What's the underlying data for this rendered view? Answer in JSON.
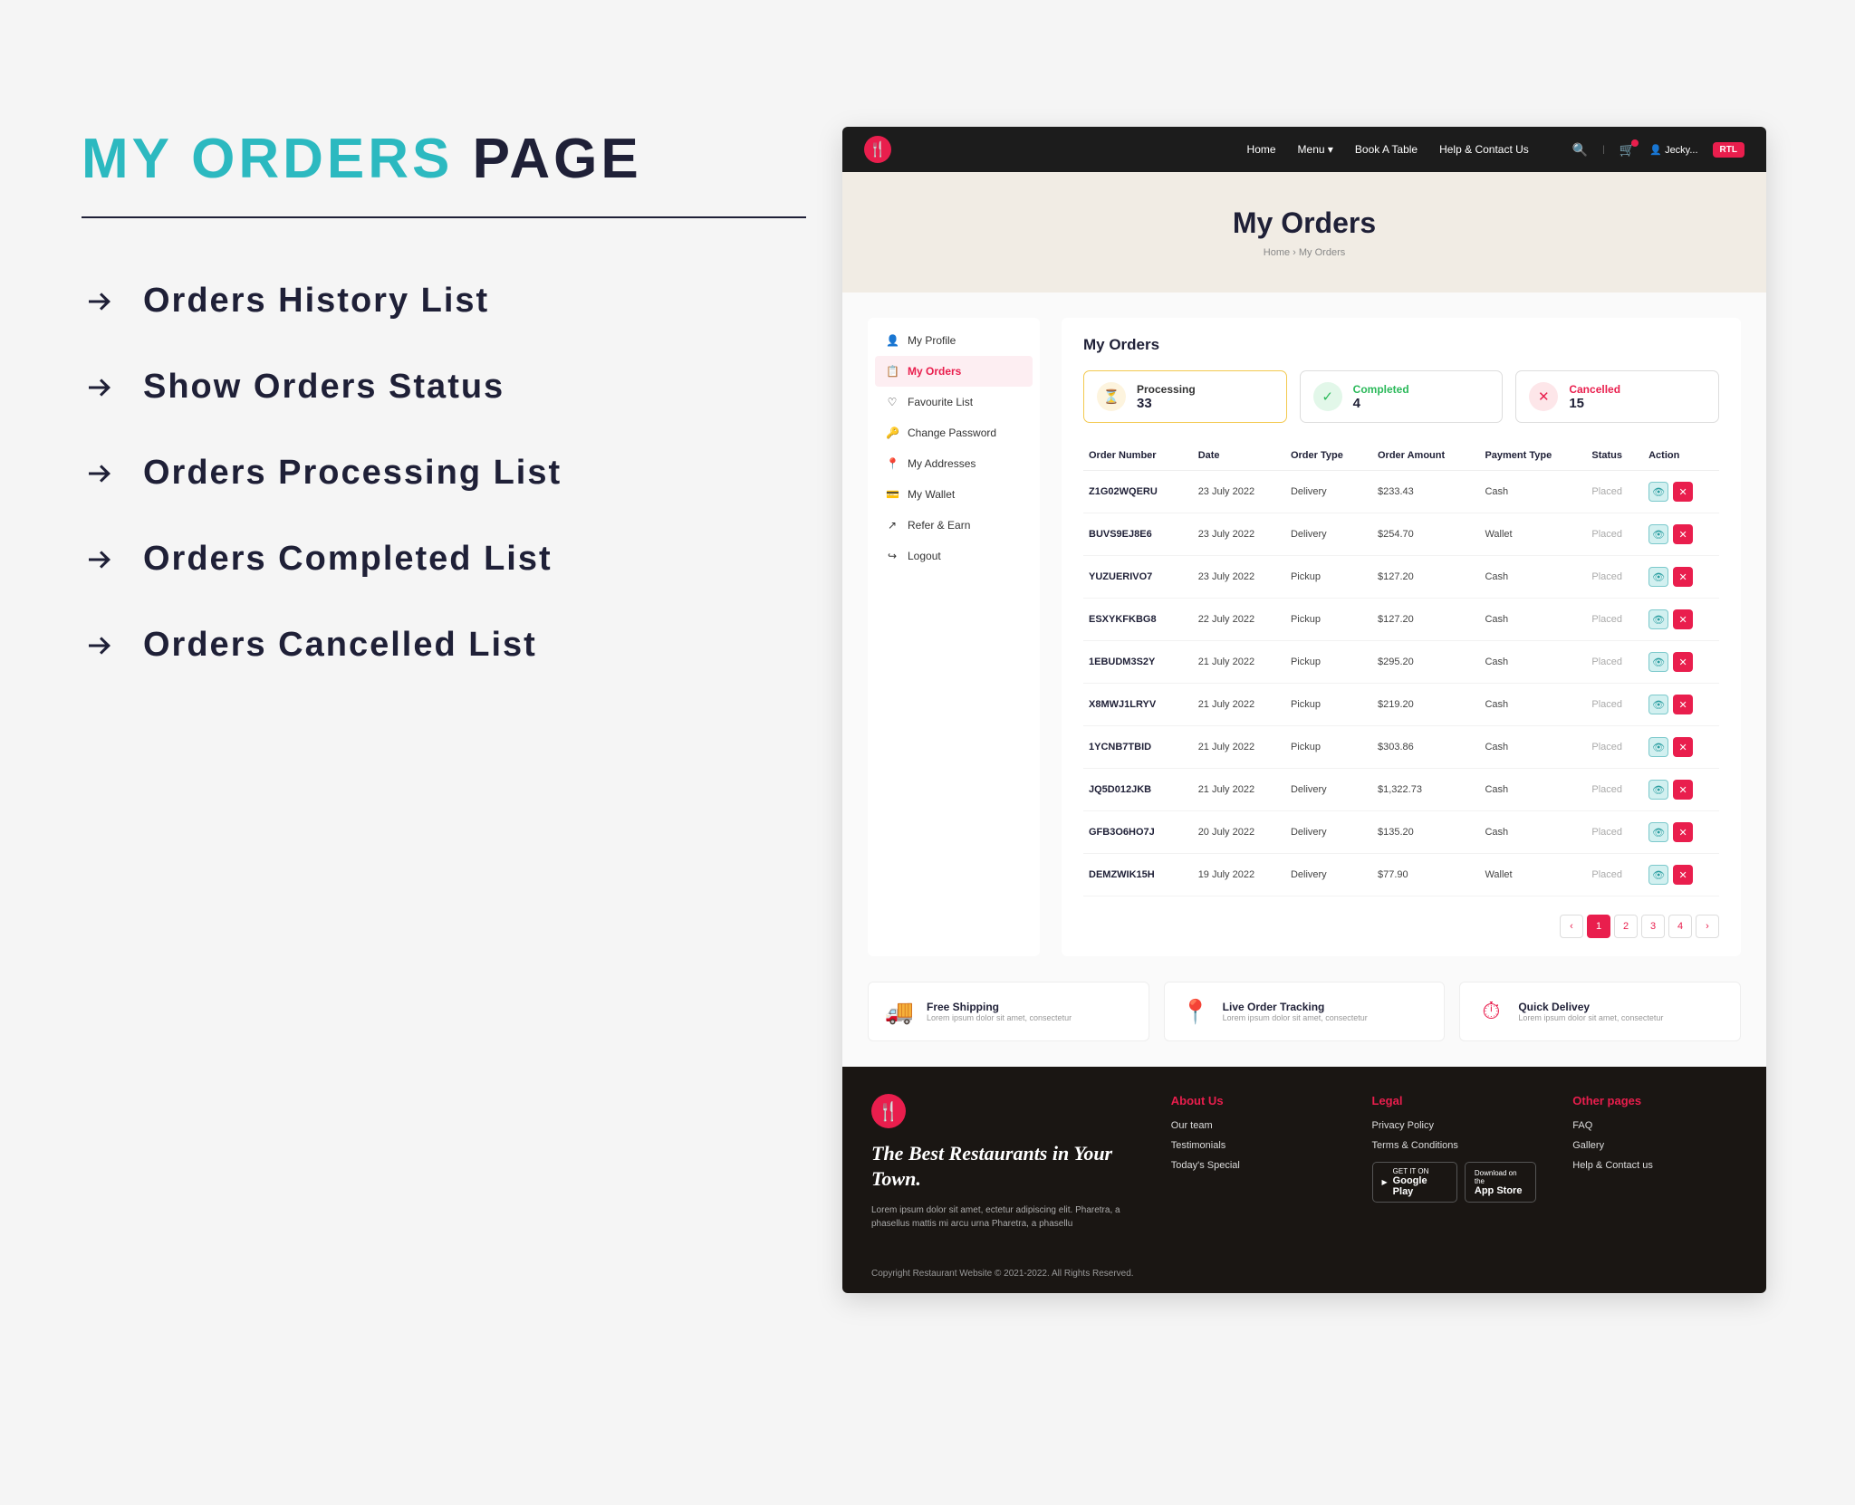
{
  "slide": {
    "title_teal": "MY ORDERS",
    "title_dark": "PAGE",
    "features": [
      "Orders History List",
      "Show Orders Status",
      "Orders Processing List",
      "Orders Completed List",
      "Orders Cancelled List"
    ]
  },
  "topbar": {
    "nav": [
      "Home",
      "Menu ▾",
      "Book A Table",
      "Help & Contact Us"
    ],
    "user": "Jecky...",
    "rtl": "RTL"
  },
  "hero": {
    "title": "My Orders",
    "crumb_home": "Home",
    "crumb_current": "My Orders"
  },
  "sidebar": {
    "items": [
      {
        "icon": "👤",
        "label": "My Profile"
      },
      {
        "icon": "📋",
        "label": "My Orders"
      },
      {
        "icon": "♡",
        "label": "Favourite List"
      },
      {
        "icon": "🔑",
        "label": "Change Password"
      },
      {
        "icon": "📍",
        "label": "My Addresses"
      },
      {
        "icon": "💳",
        "label": "My Wallet"
      },
      {
        "icon": "↗",
        "label": "Refer & Earn"
      },
      {
        "icon": "↪",
        "label": "Logout"
      }
    ]
  },
  "main": {
    "title": "My Orders",
    "status": {
      "processing": {
        "label": "Processing",
        "count": "33",
        "icon": "⏳"
      },
      "completed": {
        "label": "Completed",
        "count": "4",
        "icon": "✓"
      },
      "cancelled": {
        "label": "Cancelled",
        "count": "15",
        "icon": "✕"
      }
    },
    "columns": [
      "Order Number",
      "Date",
      "Order Type",
      "Order Amount",
      "Payment Type",
      "Status",
      "Action"
    ],
    "rows": [
      {
        "n": "Z1G02WQERU",
        "d": "23 July 2022",
        "t": "Delivery",
        "a": "$233.43",
        "p": "Cash",
        "s": "Placed"
      },
      {
        "n": "BUVS9EJ8E6",
        "d": "23 July 2022",
        "t": "Delivery",
        "a": "$254.70",
        "p": "Wallet",
        "s": "Placed"
      },
      {
        "n": "YUZUERIVO7",
        "d": "23 July 2022",
        "t": "Pickup",
        "a": "$127.20",
        "p": "Cash",
        "s": "Placed"
      },
      {
        "n": "ESXYKFKBG8",
        "d": "22 July 2022",
        "t": "Pickup",
        "a": "$127.20",
        "p": "Cash",
        "s": "Placed"
      },
      {
        "n": "1EBUDM3S2Y",
        "d": "21 July 2022",
        "t": "Pickup",
        "a": "$295.20",
        "p": "Cash",
        "s": "Placed"
      },
      {
        "n": "X8MWJ1LRYV",
        "d": "21 July 2022",
        "t": "Pickup",
        "a": "$219.20",
        "p": "Cash",
        "s": "Placed"
      },
      {
        "n": "1YCNB7TBID",
        "d": "21 July 2022",
        "t": "Pickup",
        "a": "$303.86",
        "p": "Cash",
        "s": "Placed"
      },
      {
        "n": "JQ5D012JKB",
        "d": "21 July 2022",
        "t": "Delivery",
        "a": "$1,322.73",
        "p": "Cash",
        "s": "Placed"
      },
      {
        "n": "GFB3O6HO7J",
        "d": "20 July 2022",
        "t": "Delivery",
        "a": "$135.20",
        "p": "Cash",
        "s": "Placed"
      },
      {
        "n": "DEMZWIK15H",
        "d": "19 July 2022",
        "t": "Delivery",
        "a": "$77.90",
        "p": "Wallet",
        "s": "Placed"
      }
    ],
    "pagination": [
      "‹",
      "1",
      "2",
      "3",
      "4",
      "›"
    ]
  },
  "featuresRow": [
    {
      "icon": "🚚",
      "title": "Free Shipping",
      "desc": "Lorem ipsum dolor sit amet, consectetur"
    },
    {
      "icon": "📍",
      "title": "Live Order Tracking",
      "desc": "Lorem ipsum dolor sit amet, consectetur"
    },
    {
      "icon": "⏱",
      "title": "Quick Delivey",
      "desc": "Lorem ipsum dolor sit amet, consectetur"
    }
  ],
  "footer": {
    "tagline": "The Best Restaurants in Your Town.",
    "desc": "Lorem ipsum dolor sit amet, ectetur adipiscing elit. Pharetra, a phasellus mattis mi arcu urna Pharetra, a phasellu",
    "cols": {
      "about": {
        "head": "About Us",
        "links": [
          "Our team",
          "Testimonials",
          "Today's Special"
        ]
      },
      "legal": {
        "head": "Legal",
        "links": [
          "Privacy Policy",
          "Terms & Conditions"
        ]
      },
      "other": {
        "head": "Other pages",
        "links": [
          "FAQ",
          "Gallery",
          "Help & Contact us"
        ]
      }
    },
    "badges": {
      "gp_small": "GET IT ON",
      "gp_big": "Google Play",
      "as_small": "Download on the",
      "as_big": "App Store"
    },
    "copyright": "Copyright Restaurant Website © 2021-2022. All Rights Reserved."
  }
}
